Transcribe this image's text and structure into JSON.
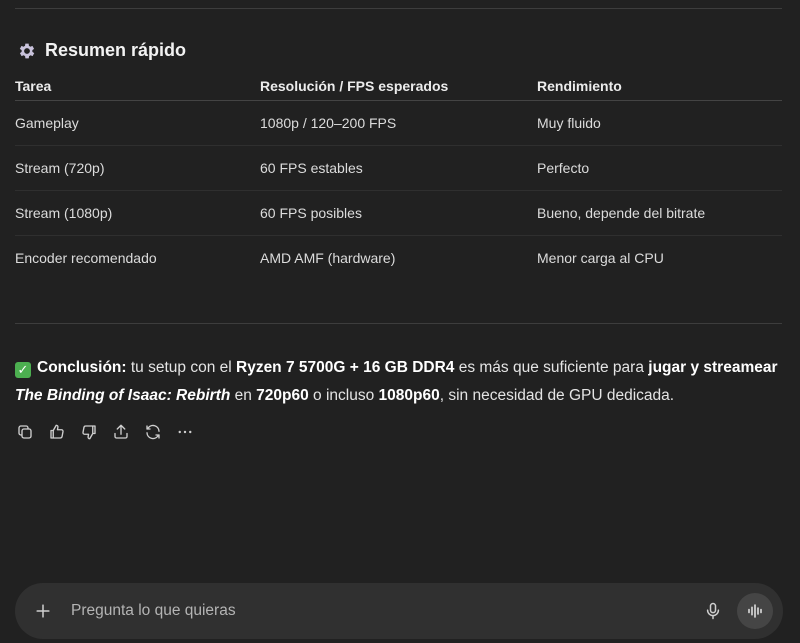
{
  "section": {
    "title": "Resumen rápido",
    "icon": "gear-icon"
  },
  "table": {
    "headers": [
      "Tarea",
      "Resolución / FPS esperados",
      "Rendimiento"
    ],
    "rows": [
      [
        "Gameplay",
        "1080p / 120–200 FPS",
        "Muy fluido"
      ],
      [
        "Stream (720p)",
        "60 FPS estables",
        "Perfecto"
      ],
      [
        "Stream (1080p)",
        "60 FPS posibles",
        "Bueno, depende del bitrate"
      ],
      [
        "Encoder recomendado",
        "AMD AMF (hardware)",
        "Menor carga al CPU"
      ]
    ]
  },
  "conclusion": {
    "check": "✓",
    "label": "Conclusión:",
    "t1": " tu setup con el ",
    "b1": "Ryzen 7 5700G + 16 GB DDR4",
    "t2": " es más que suficiente para ",
    "b2": "jugar y streamear",
    "t3": " ",
    "game": "The Binding of Isaac: Rebirth",
    "t4": " en ",
    "b3": "720p60",
    "t5": " o incluso ",
    "b4": "1080p60",
    "t6": ", sin necesidad de GPU dedicada."
  },
  "composer": {
    "placeholder": "Pregunta lo que quieras"
  },
  "colors": {
    "background": "#212121",
    "composer": "#303030",
    "check": "#4caf50"
  }
}
